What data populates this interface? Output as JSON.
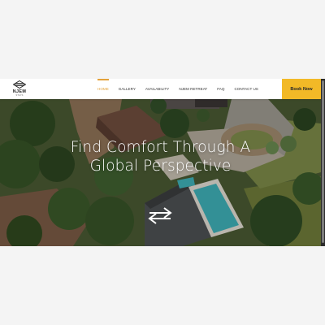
{
  "brand": {
    "name": "NJEM",
    "tagline": "STAYS"
  },
  "nav": {
    "items": [
      {
        "label": "HOME",
        "active": true
      },
      {
        "label": "GALLERY",
        "active": false
      },
      {
        "label": "AVAILABILITY",
        "active": false
      },
      {
        "label": "NJEM RETREAT",
        "active": false
      },
      {
        "label": "FAQ",
        "active": false
      },
      {
        "label": "CONTACT US",
        "active": false
      }
    ],
    "book_label": "Book Now"
  },
  "hero": {
    "headline": "Find Comfort Through A Global Perspective",
    "arrows_icon": "swap-arrows-icon"
  },
  "colors": {
    "accent": "#e3a23a",
    "book_button": "#f2b927",
    "pool": "#3fb0b8"
  }
}
